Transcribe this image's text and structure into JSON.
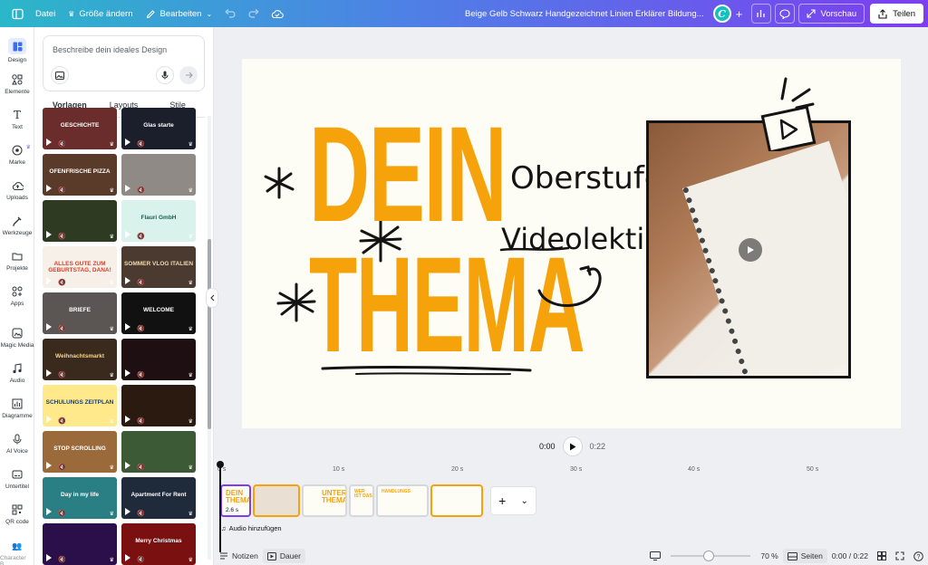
{
  "topbar": {
    "file_label": "Datei",
    "resize_label": "Größe ändern",
    "edit_label": "Bearbeiten",
    "doc_title": "Beige Gelb Schwarz Handgezeichnet Linien Erklärer Bildung...",
    "avatar_letter": "C",
    "preview_label": "Vorschau",
    "share_label": "Teilen"
  },
  "rail": {
    "items": [
      {
        "label": "Design",
        "icon": "design-icon"
      },
      {
        "label": "Elemente",
        "icon": "elements-icon"
      },
      {
        "label": "Text",
        "icon": "text-icon"
      },
      {
        "label": "Marke",
        "icon": "brand-icon"
      },
      {
        "label": "Uploads",
        "icon": "upload-icon"
      },
      {
        "label": "Werkzeuge",
        "icon": "tools-icon"
      },
      {
        "label": "Projekte",
        "icon": "folder-icon"
      },
      {
        "label": "Apps",
        "icon": "apps-icon"
      },
      {
        "label": "Magic Media",
        "icon": "magic-media-icon"
      },
      {
        "label": "Audio",
        "icon": "audio-icon"
      },
      {
        "label": "Diagramme",
        "icon": "chart-icon"
      },
      {
        "label": "AI Voice",
        "icon": "ai-voice-icon"
      },
      {
        "label": "Untertitel",
        "icon": "subtitles-icon"
      },
      {
        "label": "QR code",
        "icon": "qr-icon"
      },
      {
        "label": "Character B...",
        "icon": "character-icon"
      }
    ]
  },
  "panel": {
    "prompt_placeholder": "Beschreibe dein ideales Design",
    "tabs": [
      "Vorlagen",
      "Layouts",
      "Stile"
    ],
    "thumbs": [
      {
        "text": "GESCHICHTE",
        "bg": "#6b2c2c",
        "color": "#ffffff"
      },
      {
        "text": "Glas starte",
        "bg": "#1a1f2b",
        "color": "#ffffff"
      },
      {
        "text": "OFENFRISCHE PIZZA",
        "bg": "#5a3a28",
        "color": "#ffffff"
      },
      {
        "text": "",
        "bg": "#8f8a86",
        "color": "#ffffff"
      },
      {
        "text": "",
        "bg": "#2e3a22",
        "color": "#ffffff"
      },
      {
        "text": "Flauri GmbH",
        "bg": "#d9f3ec",
        "color": "#1e5a4e"
      },
      {
        "text": "ALLES GUTE ZUM GEBURTSTAG, DANA!",
        "bg": "#f7f0e8",
        "color": "#d9402b"
      },
      {
        "text": "SOMMER VLOG ITALIEN",
        "bg": "#4b3a30",
        "color": "#f0d9b0"
      },
      {
        "text": "BRIEFE",
        "bg": "#5b5553",
        "color": "#ffffff"
      },
      {
        "text": "WELCOME",
        "bg": "#111111",
        "color": "#ffffff"
      },
      {
        "text": "Weihnachtsmarkt",
        "bg": "#3a2a1e",
        "color": "#f5d58a"
      },
      {
        "text": "",
        "bg": "#1e0f12",
        "color": "#ffffff"
      },
      {
        "text": "SCHULUNGS ZEITPLAN",
        "bg": "#ffe98a",
        "color": "#1a3d6e"
      },
      {
        "text": "",
        "bg": "#2a1a10",
        "color": "#ffffff"
      },
      {
        "text": "STOP SCROLLING",
        "bg": "#9b6a3a",
        "color": "#ffffff"
      },
      {
        "text": "",
        "bg": "#3b5a35",
        "color": "#ffffff"
      },
      {
        "text": "Day in my life",
        "bg": "#2a7f84",
        "color": "#ffffff"
      },
      {
        "text": "Apartment For Rent",
        "bg": "#1f2a3a",
        "color": "#ffffff"
      },
      {
        "text": "",
        "bg": "#2a0f4a",
        "color": "#ffffff"
      },
      {
        "text": "Merry Christmas",
        "bg": "#7a1010",
        "color": "#ffffff"
      }
    ]
  },
  "canvas": {
    "word1": "DEIN",
    "word2": "THEMA",
    "hand1": "Oberstufe",
    "hand2": "Videolektion",
    "accent": "#f6a20b"
  },
  "playback": {
    "current": "0:00",
    "total": "0:22"
  },
  "timeline": {
    "ruler": [
      "0 s",
      "10 s",
      "20 s",
      "30 s",
      "40 s",
      "50 s"
    ],
    "clips": [
      {
        "title": "DEIN THEMA",
        "duration": "2.6 s"
      },
      {
        "title": "",
        "duration": ""
      },
      {
        "title": "UNTER THEMA",
        "duration": ""
      },
      {
        "title": "WER IST DAS",
        "duration": ""
      },
      {
        "title": "HANDLUNGS",
        "duration": ""
      },
      {
        "title": "",
        "duration": ""
      }
    ],
    "audio_label": "Audio hinzufügen"
  },
  "bottombar": {
    "notes_label": "Notizen",
    "duration_label": "Dauer",
    "zoom": "70 %",
    "pages_label": "Seiten",
    "time": "0:00 / 0:22"
  }
}
